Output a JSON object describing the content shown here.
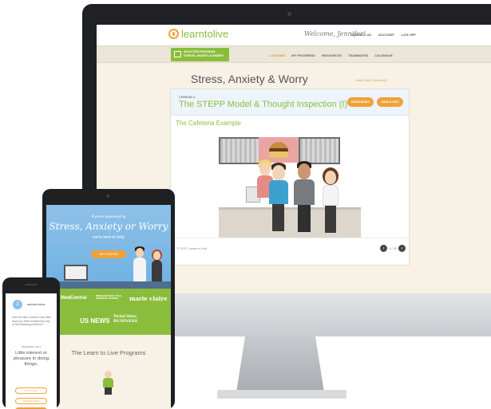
{
  "desktop": {
    "brand": "learntolive",
    "welcome": "Welcome, Jennifer!",
    "top_nav": [
      "CONTACT US",
      "ACCOUNT",
      "LOG OFF"
    ],
    "program_box": {
      "line1": "SELECTED PROGRAM:",
      "line2": "STRESS, ANXIETY & WORRY"
    },
    "sub_nav": [
      "LESSONS",
      "MY PROGRESS",
      "RESOURCES",
      "TEAMMATES",
      "CALENDAR"
    ],
    "page_title": "Stress, Anxiety & Worry",
    "how_link": "How Does This Work?",
    "lesson_number": "LESSON 2:",
    "lesson_title": "The STEPP Model & Thought Inspection (I)",
    "resources_button": "RESOURCES",
    "save_button": "SAVE & EXIT",
    "example_title": "The Cafeteria Example",
    "copyright": "© 2017 Learn to Live",
    "pager": "1 / 22"
  },
  "tablet": {
    "hero_small": "If you're experiencing",
    "hero_title": "Stress, Anxiety or Worry",
    "hero_sub": "we're here to help",
    "hero_button": "GET STARTED",
    "press": [
      "MedCentral",
      "MINNEAPOLIS/ST. PAUL BUSINESS JOURNAL",
      "marie claire",
      "US NEWS",
      "TwinCities BUSINESS"
    ],
    "programs_title": "The Learn to Live Programs"
  },
  "phone": {
    "badge": "2",
    "instructions": "INSTRUCTIONS",
    "question_intro": "Over the last 2 weeks, how often have you been bothered by any of the following problems?",
    "question_label": "QUESTION 1 OF 9",
    "question_text": "Little interest or pleasure in doing things.",
    "answers": [
      "NOT AT ALL",
      "SEVERAL DAYS"
    ]
  },
  "colors": {
    "green": "#8bbd3c",
    "orange": "#f0a23a",
    "sky": "#8ec1e8",
    "cream": "#f7f1e6"
  }
}
